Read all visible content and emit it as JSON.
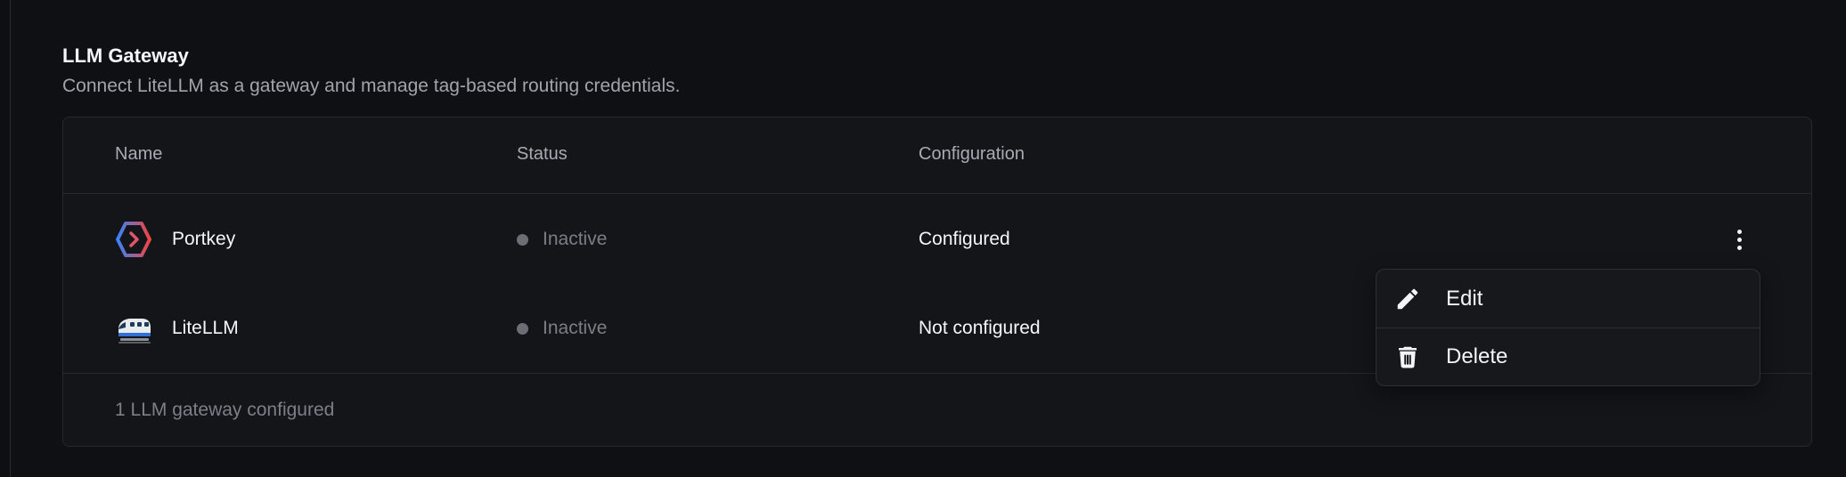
{
  "section": {
    "title": "LLM Gateway",
    "description": "Connect LiteLLM as a gateway and manage tag-based routing credentials."
  },
  "table": {
    "columns": [
      "Name",
      "Status",
      "Configuration"
    ],
    "rows": [
      {
        "name": "Portkey",
        "icon": "portkey-logo-icon",
        "status": "Inactive",
        "configuration": "Configured"
      },
      {
        "name": "LiteLLM",
        "icon": "bullet-train-icon",
        "status": "Inactive",
        "configuration": "Not configured"
      }
    ],
    "footer": "1 LLM gateway configured"
  },
  "row_menu": {
    "icon": "more-vertical-icon",
    "items": [
      {
        "label": "Edit",
        "icon": "pencil-icon"
      },
      {
        "label": "Delete",
        "icon": "trash-icon"
      }
    ]
  },
  "colors": {
    "background": "#0f1013",
    "card": "#141519",
    "border": "#26282d",
    "inactive_dot": "#6b6e75",
    "portkey_gradient_start": "#3b82f6",
    "portkey_gradient_end": "#ef4444"
  }
}
